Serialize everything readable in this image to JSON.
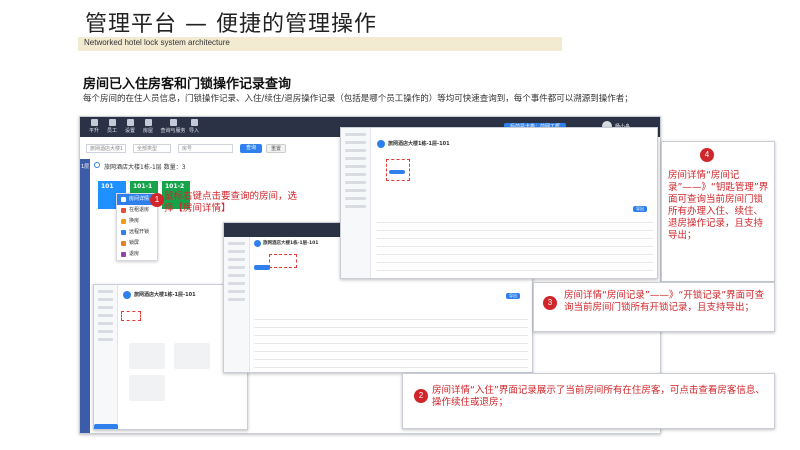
{
  "header": {
    "title": "管理平台 — 便捷的管理操作",
    "subtitle": "Networked hotel lock system architecture"
  },
  "section": {
    "heading": "房间已入住房客和门锁操作记录查询",
    "description": "每个房间的在住人员信息，门锁操作记录、入住/续住/退房操作记录（包括是哪个员工操作的）等均可快速查询到，每个事件都可以溯源到操作者；"
  },
  "main_window": {
    "nav": [
      "平升",
      "员工",
      "设置",
      "房屋",
      "查询与服务",
      "导入"
    ],
    "right_button": "后前是卡卷：前网工框",
    "user": "杨小舟",
    "filter_placeholder": "旅网酒店大楼1",
    "filter2": "全部类型",
    "search_field": "房号",
    "search_btn": "查询",
    "reset_btn": "重置",
    "floor_tag": "1层",
    "building_info": "旅网酒店大楼1栋-1层 数量：3",
    "rooms": [
      "101",
      "101-1",
      "101-2"
    ],
    "context_menu": [
      "房间详情",
      "在租退房",
      "换房",
      "远程开锁",
      "锁屏",
      "退房"
    ]
  },
  "annotations": {
    "a1": {
      "num": "1",
      "text": "鼠标右键点击要查询的房间，选择【房间详情】"
    },
    "a2": {
      "num": "2",
      "text": "房间详情“入住”界面记录展示了当前房间所有在住房客，可点击查看房客信息、操作续住或退房；"
    },
    "a3": {
      "num": "3",
      "text": "房间详情“房间记录”——》“开锁记录”界面可查询当前房间门锁所有开锁记录，且支持导出；"
    },
    "a4": {
      "num": "4",
      "text": "房间详情“房间记录”——》“钥匙管理”界面可查询当前房间门锁所有办理入住、续住、退房操作记录，且支持导出；"
    }
  },
  "detail_windows": {
    "title": "旅网酒店大楼1栋-1层-101",
    "export_btn": "导出",
    "confirm_btn": "确定"
  },
  "colors": {
    "accent": "#2f80ed",
    "annotation_red": "#d0262b",
    "nav_dark": "#2b3245",
    "subtitle_band": "#f3ead2"
  }
}
